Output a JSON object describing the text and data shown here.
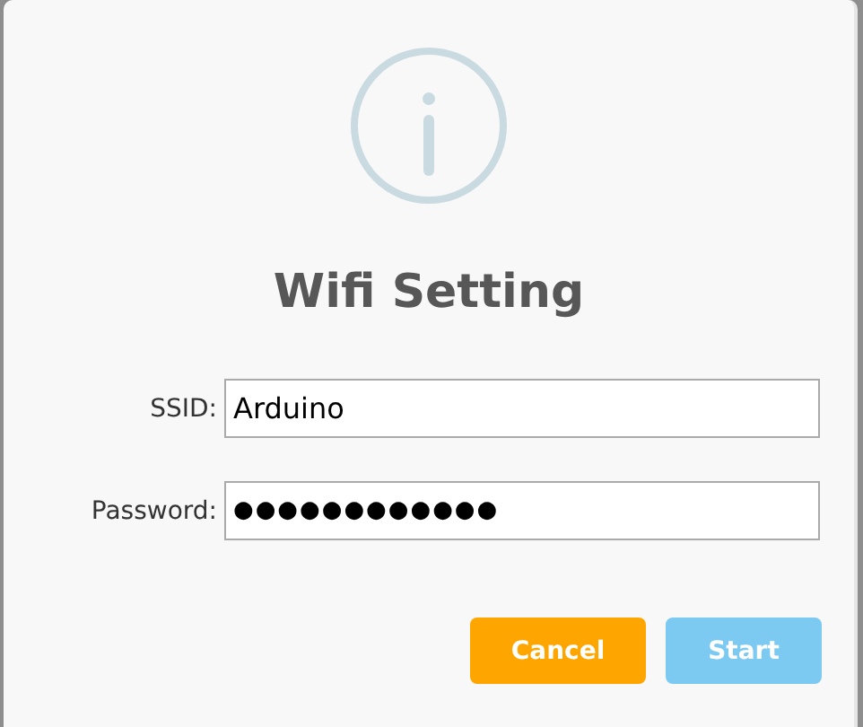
{
  "dialog": {
    "title": "Wifi Setting",
    "fields": [
      {
        "label": "SSID:",
        "kind": "text",
        "value": "Arduino"
      },
      {
        "label": "Password:",
        "kind": "password",
        "value": "●●●●●●●●●●●●"
      }
    ],
    "buttons": [
      {
        "label": "Cancel",
        "kind": "cancel",
        "disabled": false
      },
      {
        "label": "Start",
        "kind": "confirm",
        "disabled": true
      }
    ]
  }
}
